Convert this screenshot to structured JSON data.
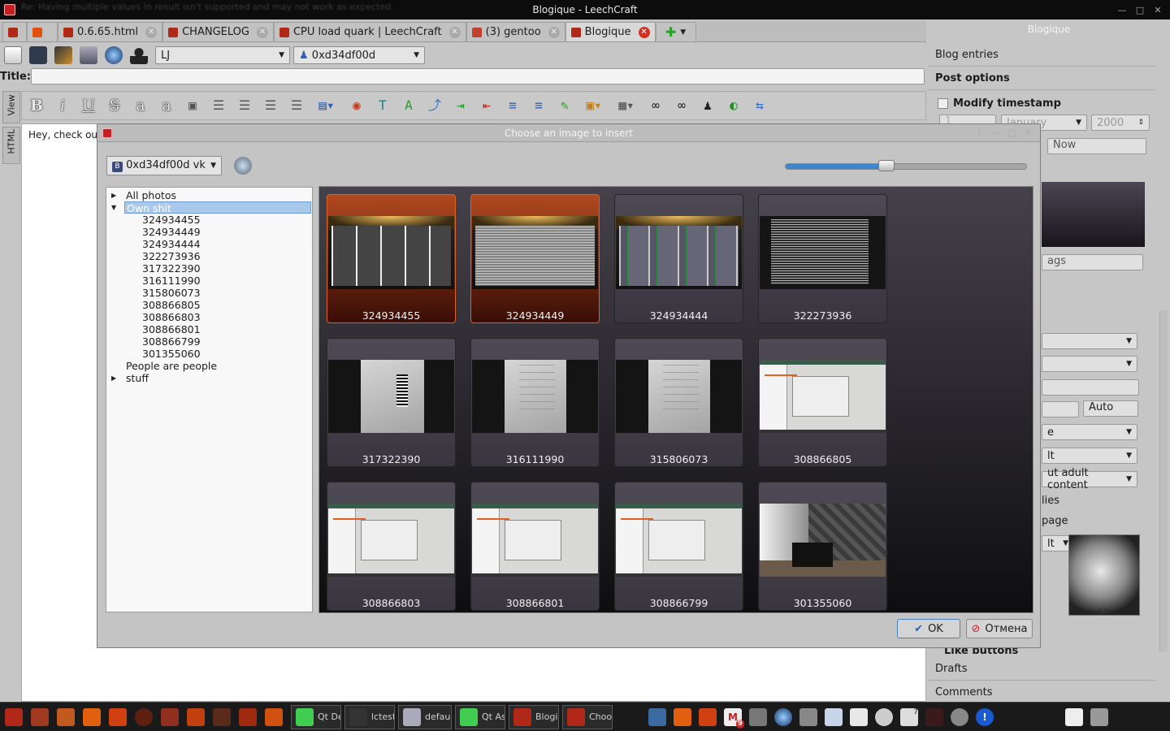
{
  "window": {
    "title": "Blogique - LeechCraft",
    "ghost_text": "Re: Having multiple values in result isn't supported and may not work as expected"
  },
  "tabs": [
    {
      "label": "",
      "icon": "leechcraft-icon",
      "active": false
    },
    {
      "label": "",
      "icon": "media-icon",
      "active": false
    },
    {
      "label": "0.6.65.html",
      "icon": "file-icon",
      "active": false
    },
    {
      "label": "CHANGELOG",
      "icon": "file-icon",
      "active": false
    },
    {
      "label": "CPU load quark | LeechCraft",
      "icon": "leechcraft-icon",
      "active": false
    },
    {
      "label": "(3) gentoo",
      "icon": "web-icon",
      "active": false
    },
    {
      "label": "Blogique",
      "icon": "blogique-icon",
      "active": true
    }
  ],
  "toolbar": {
    "account_service": "LJ",
    "account_user": "0xd34df00d"
  },
  "title_field": {
    "label": "Title:",
    "value": ""
  },
  "side_tabs": [
    "View",
    "HTML"
  ],
  "editor": {
    "text": "Hey, check out"
  },
  "right_panel": {
    "title": "Blogique",
    "blog_entries": "Blog entries",
    "post_options": "Post options",
    "modify_timestamp": "Modify timestamp",
    "day": "1",
    "month": "January",
    "year": "2000",
    "now_button": "Now",
    "tags_fragment": "ags",
    "auto_button": "Auto",
    "combo_e": "e",
    "combo_lt": "lt",
    "adult_content": "ut adult content",
    "lies": "lies",
    "page": "page",
    "combo_lt2": "lt",
    "album_caption": "rage against the mach",
    "like_buttons": "Like buttons",
    "drafts": "Drafts",
    "comments": "Comments"
  },
  "dialog": {
    "title": "Choose an image to insert",
    "account": "0xd34df00d vk",
    "zoom_percent": 42,
    "tree": {
      "all_photos": "All photos",
      "own_album": "Own shit",
      "own_items": [
        "324934455",
        "324934449",
        "324934444",
        "322273936",
        "317322390",
        "316111990",
        "315806073",
        "308866805",
        "308866803",
        "308866801",
        "308866799",
        "301355060"
      ],
      "people": "People are people",
      "stuff": "stuff"
    },
    "images": [
      {
        "caption": "324934455",
        "kind": "monitor",
        "selected": true
      },
      {
        "caption": "324934449",
        "kind": "monitor",
        "selected": true
      },
      {
        "caption": "324934444",
        "kind": "monitor",
        "selected": false
      },
      {
        "caption": "322273936",
        "kind": "monitor",
        "selected": false
      },
      {
        "caption": "317322390",
        "kind": "paper",
        "selected": false
      },
      {
        "caption": "316111990",
        "kind": "paper",
        "selected": false
      },
      {
        "caption": "315806073",
        "kind": "paper",
        "selected": false
      },
      {
        "caption": "308866805",
        "kind": "screenshot",
        "selected": false
      },
      {
        "caption": "308866803",
        "kind": "screenshot",
        "selected": false
      },
      {
        "caption": "308866801",
        "kind": "screenshot",
        "selected": false
      },
      {
        "caption": "308866799",
        "kind": "screenshot",
        "selected": false
      },
      {
        "caption": "301355060",
        "kind": "room",
        "selected": false
      }
    ],
    "ok": "OK",
    "cancel": "Отмена"
  },
  "taskbar": {
    "tasks": [
      {
        "label": "Qt De...",
        "icon": "qt-icon"
      },
      {
        "label": "lctest ...",
        "icon": "terminal-icon"
      },
      {
        "label": "defau...",
        "icon": "gear-icon"
      },
      {
        "label": "Qt As...",
        "icon": "qt-icon"
      },
      {
        "label": "Blogi...",
        "icon": "leechcraft-icon"
      },
      {
        "label": "Choo...",
        "icon": "leechcraft-icon"
      }
    ],
    "mail_count": "9",
    "desk_num": "7"
  },
  "colors": {
    "accent": "#e06020",
    "selection": "#a8c8ec",
    "dark": "#1a1a1a"
  }
}
